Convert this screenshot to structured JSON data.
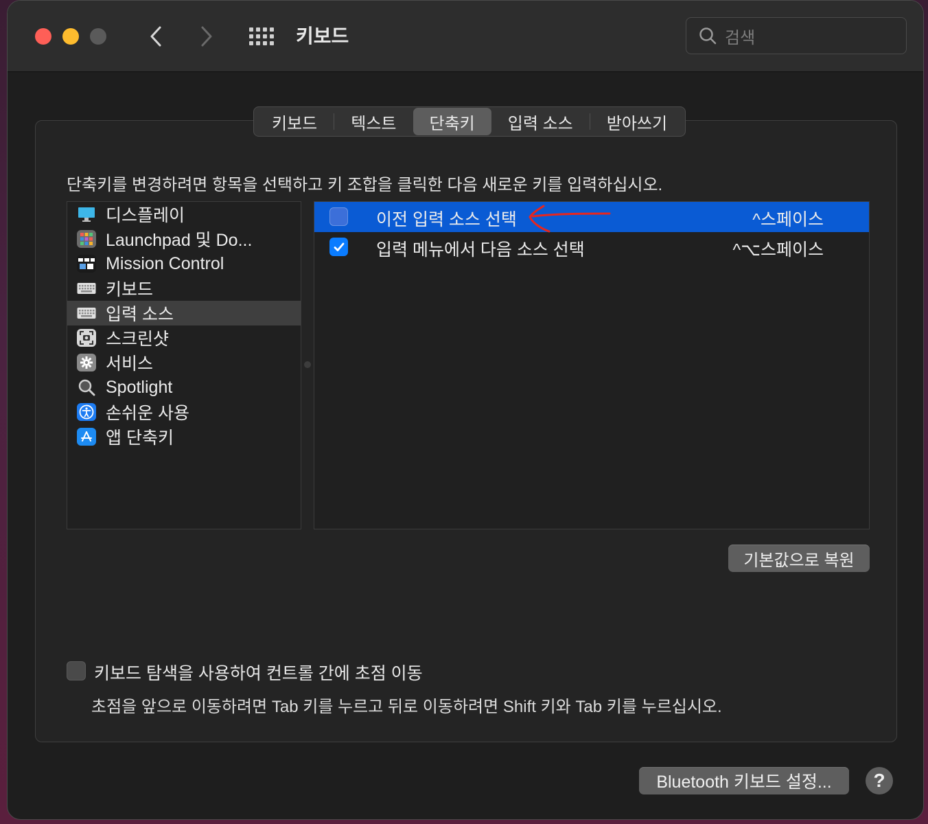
{
  "window": {
    "title": "키보드",
    "search_placeholder": "검색"
  },
  "tabs": [
    {
      "label": "키보드",
      "active": false
    },
    {
      "label": "텍스트",
      "active": false
    },
    {
      "label": "단축키",
      "active": true
    },
    {
      "label": "입력 소스",
      "active": false
    },
    {
      "label": "받아쓰기",
      "active": false
    }
  ],
  "instruction": "단축키를 변경하려면 항목을 선택하고 키 조합을 클릭한 다음 새로운 키를 입력하십시오.",
  "categories": [
    {
      "label": "디스플레이",
      "icon": "display-icon",
      "selected": false
    },
    {
      "label": "Launchpad 및 Do...",
      "icon": "launchpad-icon",
      "selected": false
    },
    {
      "label": "Mission Control",
      "icon": "mission-control-icon",
      "selected": false
    },
    {
      "label": "키보드",
      "icon": "keyboard-icon",
      "selected": false
    },
    {
      "label": "입력 소스",
      "icon": "keyboard-icon",
      "selected": true
    },
    {
      "label": "스크린샷",
      "icon": "screenshot-icon",
      "selected": false
    },
    {
      "label": "서비스",
      "icon": "gear-icon",
      "selected": false
    },
    {
      "label": "Spotlight",
      "icon": "spotlight-icon",
      "selected": false
    },
    {
      "label": "손쉬운 사용",
      "icon": "accessibility-icon",
      "selected": false
    },
    {
      "label": "앱 단축키",
      "icon": "app-store-icon",
      "selected": false
    }
  ],
  "shortcuts": [
    {
      "label": "이전 입력 소스 선택",
      "key": "^스페이스",
      "checked": false,
      "selected": true
    },
    {
      "label": "입력 메뉴에서 다음 소스 선택",
      "key": "^⌥스페이스",
      "checked": true,
      "selected": false
    }
  ],
  "restore_button": "기본값으로 복원",
  "keyboard_nav": {
    "label": "키보드 탐색을 사용하여 컨트롤 간에 초점 이동",
    "checked": false,
    "hint": "초점을 앞으로 이동하려면 Tab 키를 누르고 뒤로 이동하려면 Shift 키와 Tab 키를 누르십시오."
  },
  "bluetooth_button": "Bluetooth 키보드 설정...",
  "help_button": "?",
  "colors": {
    "accent": "#0a5bd4",
    "annotation": "#e8261e"
  }
}
